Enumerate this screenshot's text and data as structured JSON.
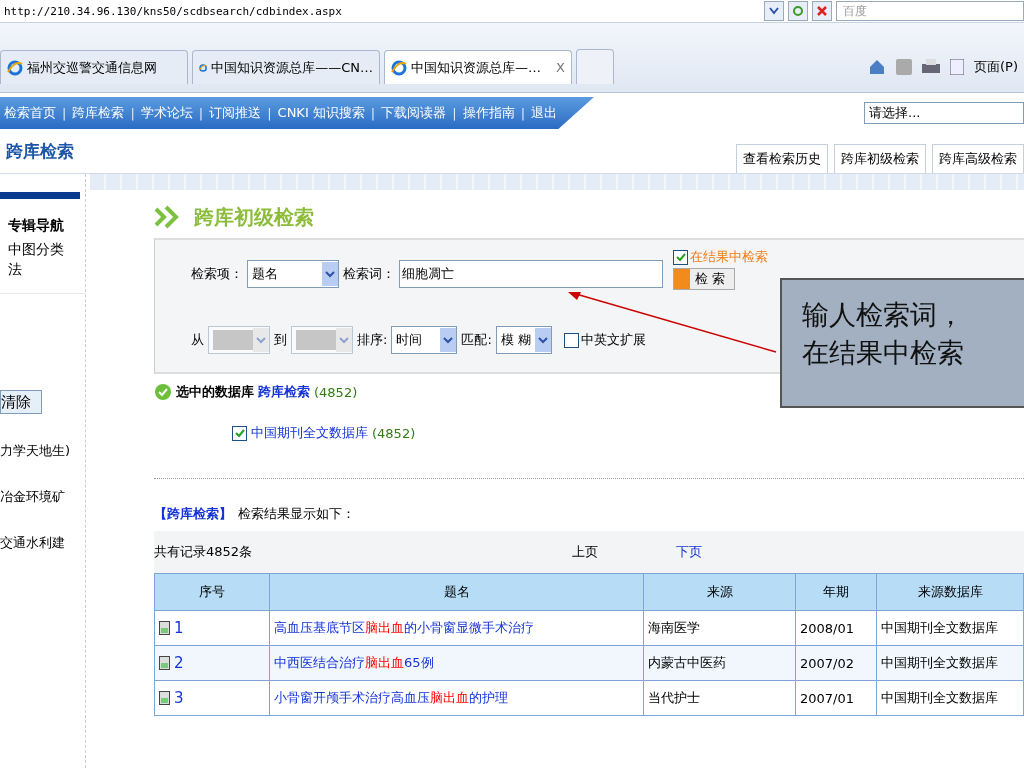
{
  "browser": {
    "address": "http://210.34.96.130/kns50/scdbsearch/cdbindex.aspx",
    "search_placeholder": "百度",
    "tabs": [
      {
        "label": "福州交巡警交通信息网",
        "selected": false
      },
      {
        "label": "中国知识资源总库——CN…",
        "selected": false
      },
      {
        "label": "中国知识资源总库—…",
        "selected": true
      }
    ],
    "close_tab": "X",
    "page_menu": "页面(P)"
  },
  "nav": {
    "items": [
      "检索首页",
      "跨库检索",
      "学术论坛",
      "订阅推送",
      "CNKI 知识搜索",
      "下载阅读器",
      "操作指南",
      "退出"
    ],
    "separator": "|",
    "select": "请选择..."
  },
  "header": {
    "title": "跨库检索",
    "tabs": [
      {
        "label": "查看检索历史",
        "selected": false
      },
      {
        "label": "跨库初级检索",
        "selected": false
      },
      {
        "label": "跨库高级检索",
        "selected": false
      }
    ]
  },
  "sidebar": {
    "heading": "专辑导航",
    "item": "中图分类法",
    "clear_button": "清除",
    "lines": [
      "力学天地生)",
      "冶金环境矿",
      "交通水利建"
    ]
  },
  "search": {
    "title": "跨库初级检索",
    "field_label": "检索项：",
    "field": {
      "value": "题名"
    },
    "term_label": "检索词：",
    "term": "细胞凋亡",
    "in_results": {
      "label": "在结果中检索",
      "checked": true
    },
    "search_button": "检 索",
    "from_label": "从",
    "from": {
      "disabled": true
    },
    "to_label": "到",
    "to": {
      "disabled": true
    },
    "sort_label": "排序:",
    "sort": {
      "value": "时间"
    },
    "match_label": "匹配:",
    "match": {
      "value": "模 糊"
    },
    "expand": {
      "label": "中英文扩展",
      "checked": false
    }
  },
  "callout": [
    "输人检索词，",
    "在结果中检索"
  ],
  "selected_db": {
    "label": "选中的数据库",
    "link": "跨库检索",
    "count": "(4852)"
  },
  "databases": [
    {
      "label": "中国期刊全文数据库",
      "count": "(4852)",
      "checked": true
    }
  ],
  "results": {
    "heading": "【跨库检索】",
    "caption": "检索结果显示如下：",
    "total": "共有记录4852条",
    "prev": "上页",
    "next": "下页",
    "columns": [
      "序号",
      "题名",
      "来源",
      "年期",
      "来源数据库"
    ],
    "rows": [
      {
        "no": "1",
        "title": "高血压基底节区**脑出血**的小骨窗显微手术治疗",
        "source": "海南医学",
        "issue": "2008/01",
        "db": "中国期刊全文数据库"
      },
      {
        "no": "2",
        "title": "中西医结合治疗**脑出血**65例",
        "source": "内蒙古中医药",
        "issue": "2007/02",
        "db": "中国期刊全文数据库"
      },
      {
        "no": "3",
        "title": "小骨窗开颅手术治疗高血压**脑出血**的护理",
        "source": "当代护士",
        "issue": "2007/01",
        "db": "中国期刊全文数据库"
      }
    ]
  }
}
